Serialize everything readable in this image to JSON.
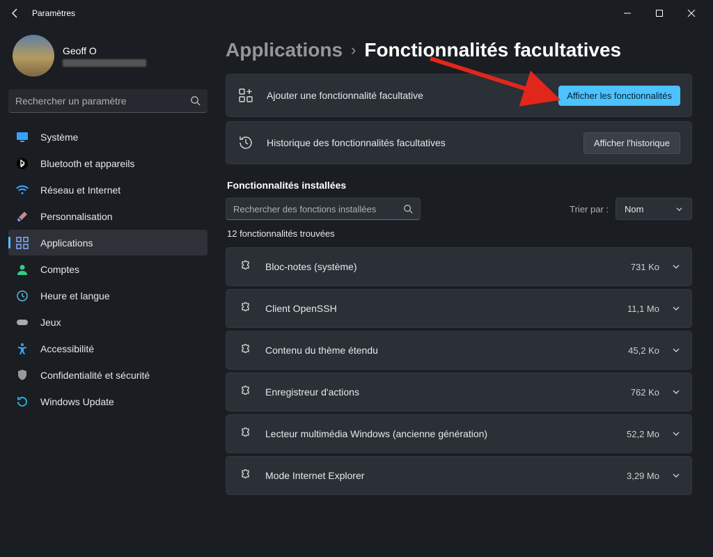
{
  "window": {
    "title": "Paramètres"
  },
  "profile": {
    "name": "Geoff O"
  },
  "search": {
    "placeholder": "Rechercher un paramètre"
  },
  "nav": {
    "items": [
      {
        "label": "Système",
        "icon": "display"
      },
      {
        "label": "Bluetooth et appareils",
        "icon": "bluetooth"
      },
      {
        "label": "Réseau et Internet",
        "icon": "wifi"
      },
      {
        "label": "Personnalisation",
        "icon": "brush"
      },
      {
        "label": "Applications",
        "icon": "apps",
        "active": true
      },
      {
        "label": "Comptes",
        "icon": "person"
      },
      {
        "label": "Heure et langue",
        "icon": "clock"
      },
      {
        "label": "Jeux",
        "icon": "gamepad"
      },
      {
        "label": "Accessibilité",
        "icon": "accessibility"
      },
      {
        "label": "Confidentialité et sécurité",
        "icon": "shield"
      },
      {
        "label": "Windows Update",
        "icon": "update"
      }
    ]
  },
  "breadcrumb": {
    "level1": "Applications",
    "level2": "Fonctionnalités facultatives"
  },
  "cards": {
    "add": {
      "label": "Ajouter une fonctionnalité facultative",
      "button": "Afficher les fonctionnalités"
    },
    "history": {
      "label": "Historique des fonctionnalités facultatives",
      "button": "Afficher l'historique"
    }
  },
  "installed": {
    "heading": "Fonctionnalités installées",
    "search_placeholder": "Rechercher des fonctions installées",
    "sort_label": "Trier par :",
    "sort_value": "Nom",
    "count": "12 fonctionnalités trouvées",
    "items": [
      {
        "name": "Bloc-notes (système)",
        "size": "731 Ko"
      },
      {
        "name": "Client OpenSSH",
        "size": "11,1 Mo"
      },
      {
        "name": "Contenu du thème étendu",
        "size": "45,2 Ko"
      },
      {
        "name": "Enregistreur d'actions",
        "size": "762 Ko"
      },
      {
        "name": "Lecteur multimédia Windows (ancienne génération)",
        "size": "52,2 Mo"
      },
      {
        "name": "Mode Internet Explorer",
        "size": "3,29 Mo"
      }
    ]
  }
}
